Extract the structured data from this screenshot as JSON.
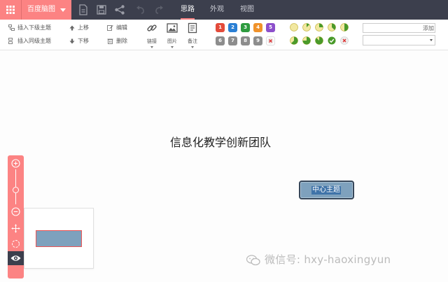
{
  "app": {
    "brand": "百度脑图"
  },
  "menu": {
    "tabs": [
      {
        "label": "思路"
      },
      {
        "label": "外观"
      },
      {
        "label": "视图"
      }
    ],
    "active": "思路"
  },
  "toolbar": {
    "insert_child": "插入下级主题",
    "insert_sibling": "插入同级主题",
    "move_up": "上移",
    "move_down": "下移",
    "edit": "编辑",
    "delete": "删除",
    "link": "链接",
    "image": "图片",
    "note": "备注",
    "priorities": [
      "1",
      "2",
      "3",
      "4",
      "5",
      "6",
      "7",
      "8",
      "9"
    ],
    "priority_colors": [
      "#e34b3b",
      "#2a7fd4",
      "#2e9b3f",
      "#f0922b",
      "#8c4fcb",
      "#8d8d8d",
      "#8d8d8d",
      "#8d8d8d",
      "#8d8d8d"
    ],
    "progress_levels": [
      0,
      0.125,
      0.25,
      0.375,
      0.5,
      0.625,
      0.75,
      0.875,
      1
    ],
    "resource_add": "添加"
  },
  "canvas": {
    "title": "信息化教学创新团队",
    "center_node": "中心主题"
  },
  "watermark": "微信号: hxy-haoxingyun",
  "colors": {
    "accent": "#fc8383",
    "topbar": "#3c3f4d",
    "node_fill": "#7ea1bd",
    "node_border": "#37475a"
  }
}
